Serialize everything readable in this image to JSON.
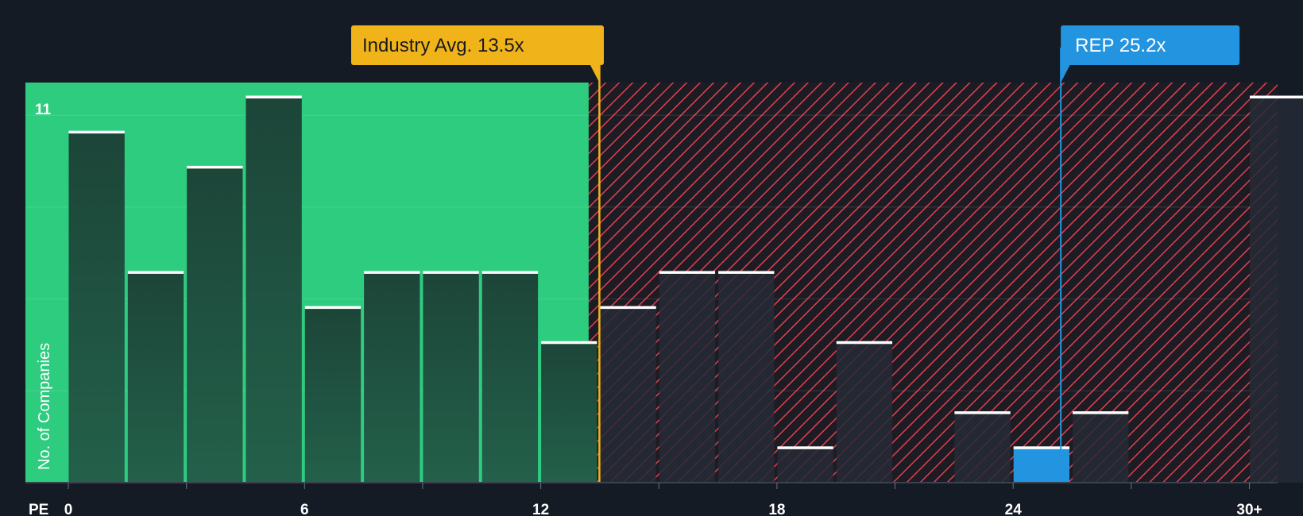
{
  "chart_data": {
    "type": "bar",
    "xlabel": "PE",
    "ylabel": "No. of Companies",
    "x_ticks": [
      "0",
      "6",
      "12",
      "18",
      "24",
      "30+"
    ],
    "y_ticks": [
      "11"
    ],
    "ylim": [
      0,
      11
    ],
    "bins": [
      {
        "start": 0,
        "end": 1.5,
        "value": 10
      },
      {
        "start": 1.5,
        "end": 3,
        "value": 6
      },
      {
        "start": 3,
        "end": 4.5,
        "value": 9
      },
      {
        "start": 4.5,
        "end": 6,
        "value": 11
      },
      {
        "start": 6,
        "end": 7.5,
        "value": 5
      },
      {
        "start": 7.5,
        "end": 9,
        "value": 6
      },
      {
        "start": 9,
        "end": 10.5,
        "value": 6
      },
      {
        "start": 10.5,
        "end": 12,
        "value": 6
      },
      {
        "start": 12,
        "end": 13.5,
        "value": 4
      },
      {
        "start": 13.5,
        "end": 15,
        "value": 5
      },
      {
        "start": 15,
        "end": 16.5,
        "value": 6
      },
      {
        "start": 16.5,
        "end": 18,
        "value": 6
      },
      {
        "start": 18,
        "end": 19.5,
        "value": 1
      },
      {
        "start": 19.5,
        "end": 21,
        "value": 4
      },
      {
        "start": 21,
        "end": 22.5,
        "value": 0
      },
      {
        "start": 22.5,
        "end": 24,
        "value": 2
      },
      {
        "start": 24,
        "end": 25.5,
        "value": 1,
        "highlight": true
      },
      {
        "start": 25.5,
        "end": 27,
        "value": 2
      },
      {
        "start": 27,
        "end": 28.5,
        "value": 0
      },
      {
        "start": 28.5,
        "end": 30,
        "value": 0
      },
      {
        "start": 30,
        "end": 31.5,
        "value": 11
      }
    ],
    "industry_avg": {
      "label": "Industry Avg. 13.5x",
      "value": 13.5
    },
    "company": {
      "label": "REP 25.2x",
      "value": 25.2
    },
    "fair_region_end": 13.5,
    "colors": {
      "background": "#151b24",
      "green_region": "#2ecc7f",
      "green_bar": "#1e4a3c",
      "red_hatch": "#e0414a",
      "red_bar": "#252a36",
      "highlight_bar": "#2394e0",
      "industry_label_bg": "#f0b31a",
      "company_label_bg": "#2394e0",
      "bar_top": "#ffffff"
    }
  }
}
